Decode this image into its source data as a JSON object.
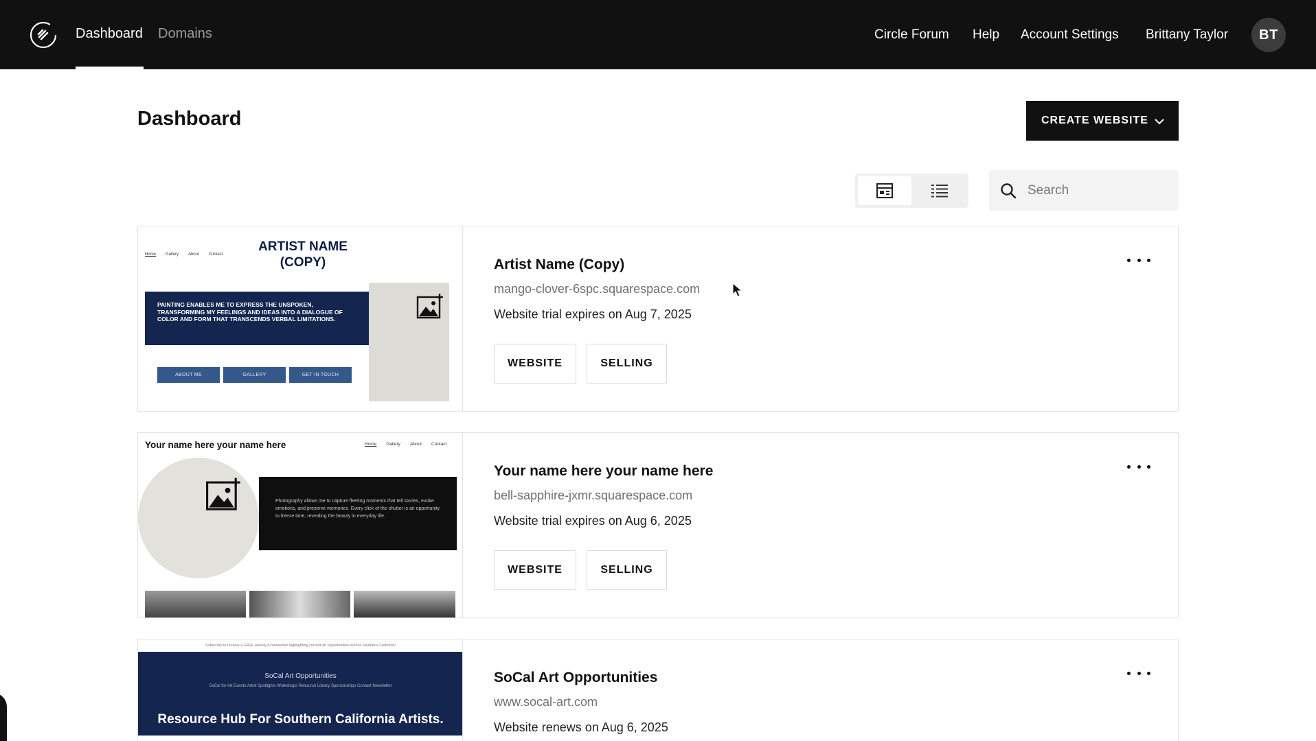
{
  "nav": {
    "logo_icon": "squarespace-logo-icon",
    "links": [
      {
        "label": "Dashboard",
        "active": true
      },
      {
        "label": "Domains",
        "active": false
      }
    ],
    "right_links": [
      "Circle Forum",
      "Help",
      "Account Settings"
    ],
    "user_name": "Brittany Taylor",
    "avatar_initials": "BT"
  },
  "header": {
    "title": "Dashboard",
    "create_button": "CREATE WEBSITE"
  },
  "toolbar": {
    "view_modes": [
      "grid-view-icon",
      "list-view-icon"
    ],
    "active_view": "grid-view-icon",
    "search_placeholder": "Search",
    "search_value": ""
  },
  "sites": [
    {
      "name": "Artist Name (Copy)",
      "domain": "mango-clover-6spc.squarespace.com",
      "status": "Website trial expires on Aug 7, 2025",
      "buttons": [
        "WEBSITE",
        "SELLING"
      ],
      "preview": {
        "nav": [
          "Home",
          "Gallery",
          "About",
          "Contact"
        ],
        "title": "ARTIST NAME (COPY)",
        "banner": "PAINTING ENABLES ME TO EXPRESS THE UNSPOKEN, TRANSFORMING MY FEELINGS AND IDEAS INTO A DIALOGUE OF COLOR AND FORM THAT TRANSCENDS VERBAL LIMITATIONS.",
        "buttons": [
          "ABOUT ME",
          "GALLERY",
          "GET IN TOUCH"
        ]
      }
    },
    {
      "name": "Your name here your name here",
      "domain": "bell-sapphire-jxmr.squarespace.com",
      "status": "Website trial expires on Aug 6, 2025",
      "buttons": [
        "WEBSITE",
        "SELLING"
      ],
      "preview": {
        "heading": "Your name here your name here",
        "nav": [
          "Home",
          "Gallery",
          "About",
          "Contact"
        ],
        "text": "Photography allows me to capture fleeting moments that tell stories, evoke emotions, and preserve memories. Every click of the shutter is an opportunity to freeze time, revealing the beauty in everyday life."
      }
    },
    {
      "name": "SoCal Art Opportunities",
      "domain": "www.socal-art.com",
      "status": "Website renews on Aug 6, 2025",
      "buttons": [],
      "preview": {
        "top": "Subscribe to receive a FREE weekly e-newsletter highlighting current art opportunities across Southern California!",
        "small_title": "SoCal Art Opportunities",
        "links": "SoCal for Art   Events   Artist Spotlights   Workshops   Resource Library   Sponsorships   Contact   Newsletter",
        "headline": "Resource Hub For Southern California Artists."
      }
    }
  ],
  "colors": {
    "nav_bg": "#111111",
    "preview_navy": "#14264f",
    "preview_button": "#35588c"
  }
}
